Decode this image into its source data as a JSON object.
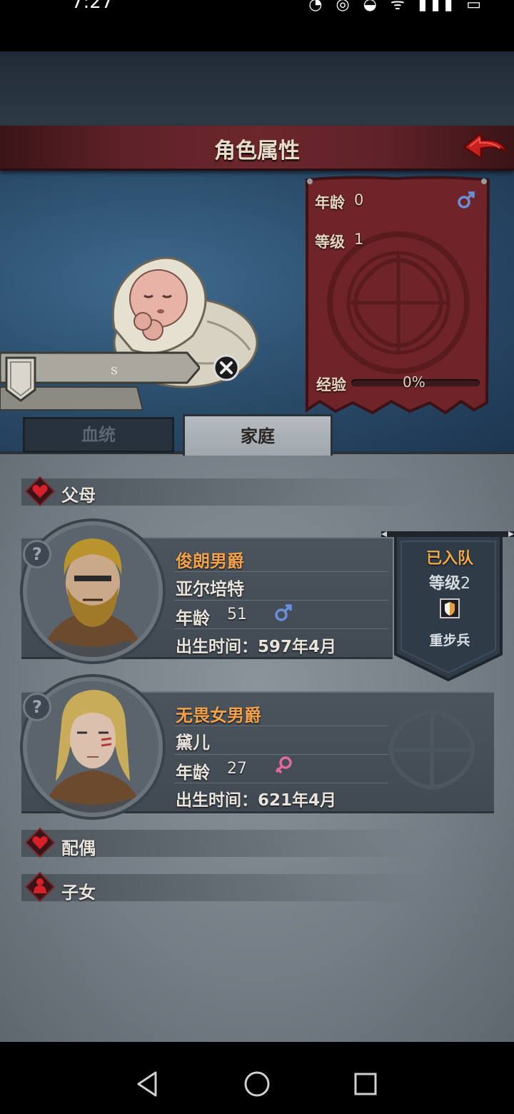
{
  "status_bar": {
    "time": "7:27",
    "icons_text": "◔ ◎ ◒ ᯤ ▮▮▮ ▭"
  },
  "header": {
    "title": "角色属性",
    "back_icon": "back-arrow-icon",
    "accent": "#c8201e"
  },
  "character": {
    "name": "s",
    "age_label": "年龄",
    "age_value": "0",
    "gender_icon": "male-icon",
    "level_label": "等级",
    "level_value": "1",
    "exp_label": "经验",
    "exp_value": "0%",
    "exp_fraction": 0.0
  },
  "tabs": [
    {
      "label": "血统",
      "active": false
    },
    {
      "label": "家庭",
      "active": true
    }
  ],
  "sections": {
    "parents": "父母",
    "spouse": "配偶",
    "children": "子女"
  },
  "parents": [
    {
      "title": "俊朗男爵",
      "name": "亚尔培特",
      "age_label": "年龄",
      "age_value": "51",
      "gender_icon": "male-icon",
      "birth_label": "出生时间：",
      "birth_value": "597年4月",
      "help_icon": "?",
      "status": {
        "joined": "已入队",
        "level_label": "等级",
        "level_value": "2",
        "class": "重步兵",
        "class_icon": "shield-icon"
      }
    },
    {
      "title": "无畏女男爵",
      "name": "黛儿",
      "age_label": "年龄",
      "age_value": "27",
      "gender_icon": "female-icon",
      "birth_label": "出生时间：",
      "birth_value": "621年4月",
      "help_icon": "?"
    }
  ],
  "colors": {
    "title_orange": "#f2a24a",
    "male_blue": "#6a8fd8",
    "female_pink": "#e06aa0",
    "heart_red": "#c8222a",
    "pennant_orange": "#f0a848"
  }
}
